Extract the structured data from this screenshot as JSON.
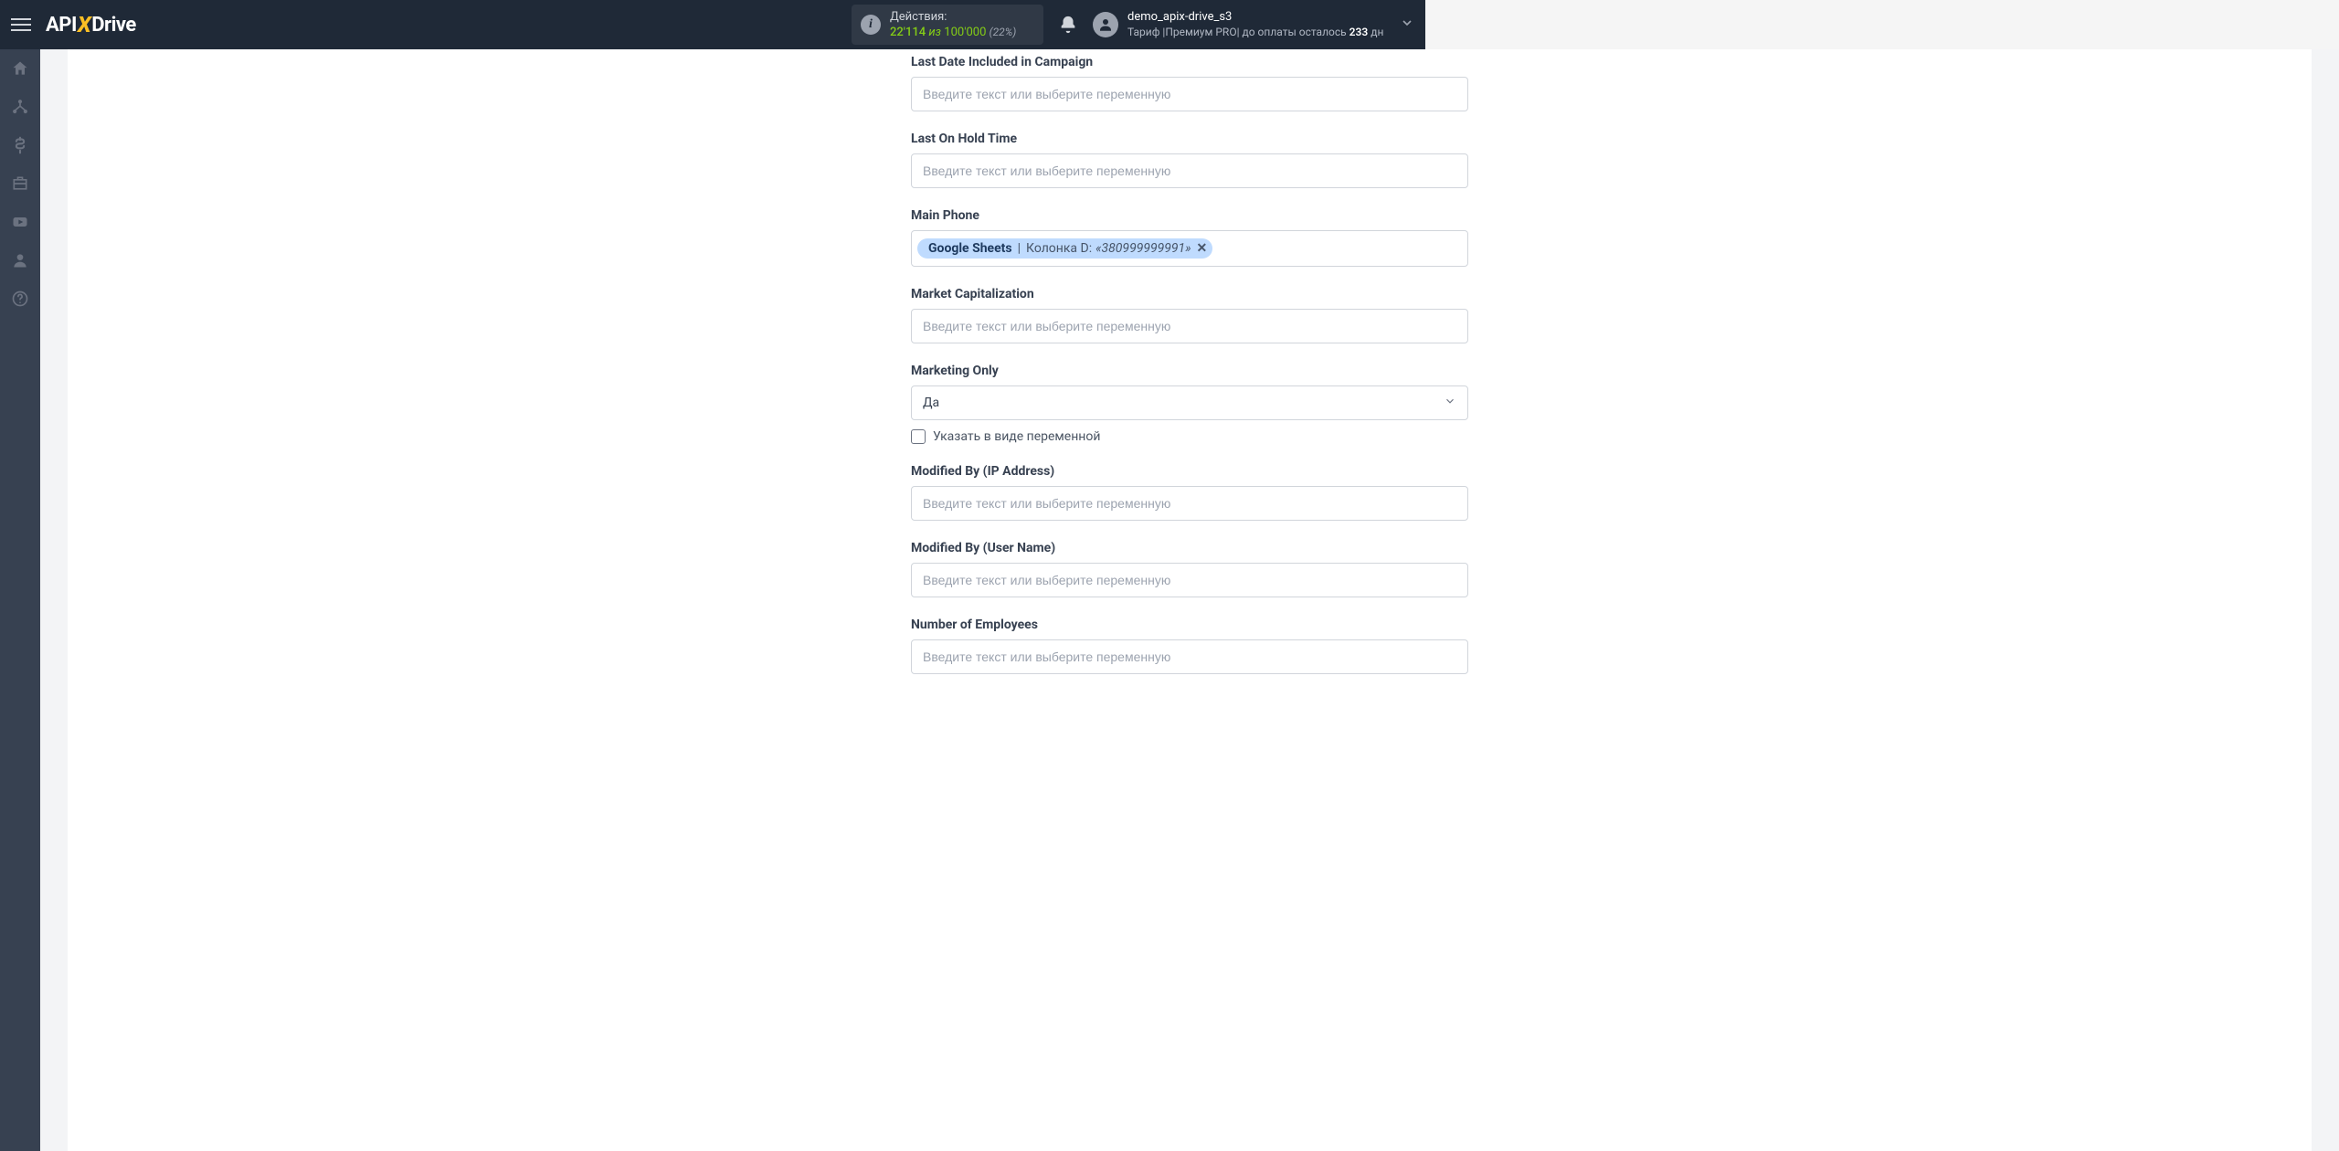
{
  "header": {
    "logo_api": "API",
    "logo_x": "X",
    "logo_drive": "Drive",
    "actions": {
      "label": "Действия:",
      "used": "22'114",
      "of": "из",
      "total": "100'000",
      "percent": "(22%)"
    },
    "user": {
      "name": "demo_apix-drive_s3",
      "tariff_label": "Тариф |",
      "tariff_plan": "Премиум PRO",
      "remaining_prefix": "| до оплаты осталось ",
      "remaining_days": "233",
      "remaining_suffix": " дн"
    }
  },
  "form": {
    "placeholder": "Введите текст или выберите переменную",
    "fields": {
      "last_date": {
        "label": "Last Date Included in Campaign"
      },
      "last_hold": {
        "label": "Last On Hold Time"
      },
      "main_phone": {
        "label": "Main Phone",
        "tag_source": "Google Sheets",
        "tag_column": "Колонка D:",
        "tag_value": "«380999999991»"
      },
      "market_cap": {
        "label": "Market Capitalization"
      },
      "marketing_only": {
        "label": "Marketing Only",
        "selected": "Да",
        "checkbox_label": "Указать в виде переменной"
      },
      "modified_ip": {
        "label": "Modified By (IP Address)"
      },
      "modified_user": {
        "label": "Modified By (User Name)"
      },
      "num_employees": {
        "label": "Number of Employees"
      }
    }
  }
}
